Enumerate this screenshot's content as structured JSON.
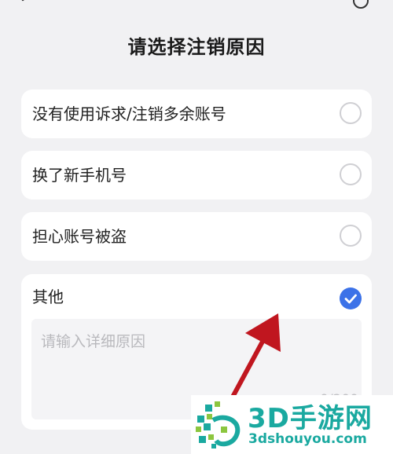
{
  "header": {
    "title": "请选择注销原因"
  },
  "options": [
    {
      "label": "没有使用诉求/注销多余账号",
      "selected": false
    },
    {
      "label": "换了新手机号",
      "selected": false
    },
    {
      "label": "担心账号被盗",
      "selected": false
    },
    {
      "label": "其他",
      "selected": true
    }
  ],
  "other_input": {
    "placeholder": "请输入详细原因",
    "value": "",
    "counter": "0/200"
  },
  "watermark": {
    "brand": "3D手游网",
    "url": "3dshouyou.com"
  },
  "colors": {
    "accent": "#3c72e8",
    "annotation_arrow": "#c0161f",
    "watermark": "#1aa9a0"
  },
  "icons": [
    "back-arrow-icon",
    "help-icon",
    "checkmark-icon",
    "3d-logo-icon"
  ]
}
